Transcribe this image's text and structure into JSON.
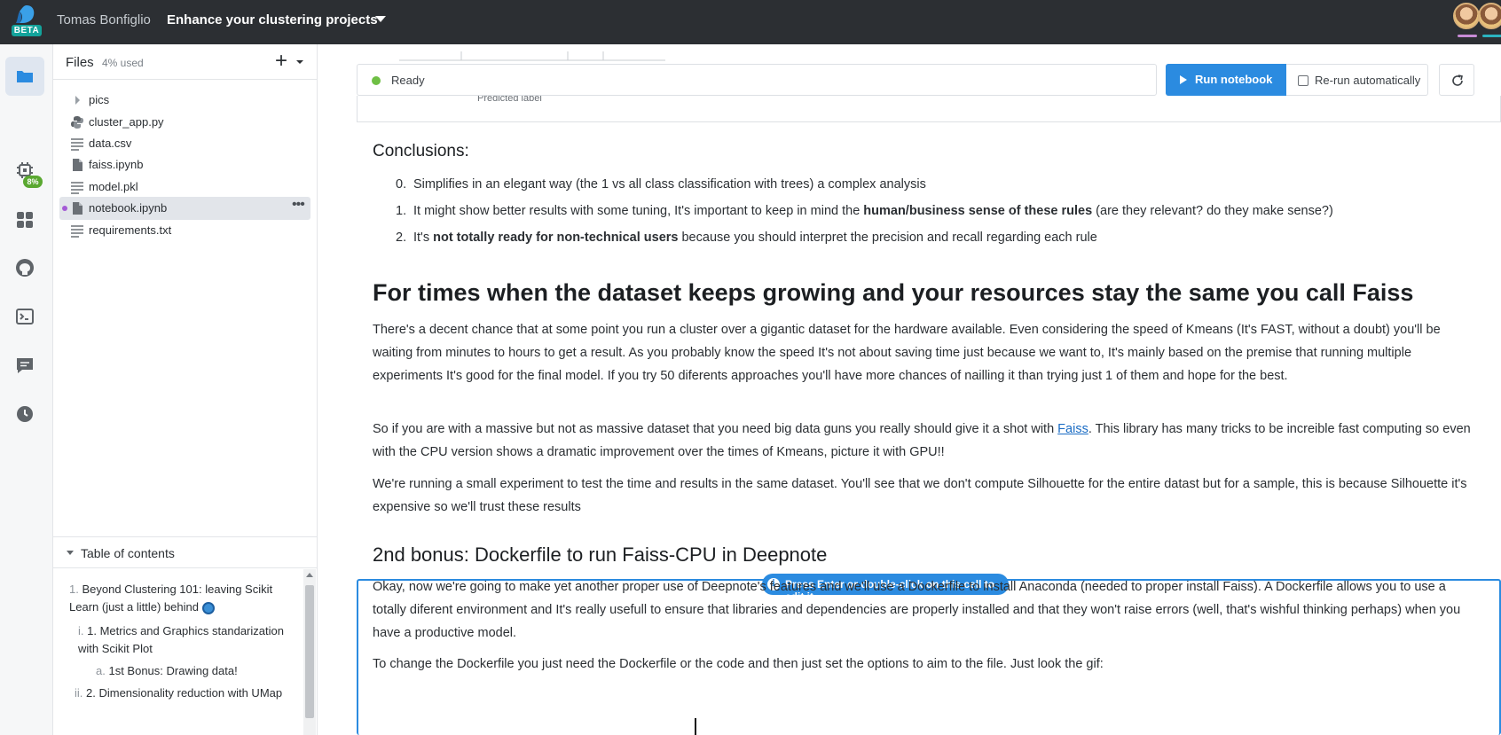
{
  "topbar": {
    "owner": "Tomas Bonfiglio",
    "project_title": "Enhance your clustering projects",
    "beta_label": "BETA",
    "accent": "#13a39b"
  },
  "rail": {
    "icons": [
      "folder-icon",
      "environment-icon",
      "integrations-icon",
      "github-icon",
      "terminal-icon",
      "comments-icon",
      "history-icon"
    ],
    "environment_usage": "8%"
  },
  "files": {
    "title": "Files",
    "usage": "4% used",
    "items": [
      {
        "name": "pics",
        "type": "folder"
      },
      {
        "name": "cluster_app.py",
        "type": "python"
      },
      {
        "name": "data.csv",
        "type": "text"
      },
      {
        "name": "faiss.ipynb",
        "type": "notebook"
      },
      {
        "name": "model.pkl",
        "type": "text"
      },
      {
        "name": "notebook.ipynb",
        "type": "notebook",
        "selected": true
      },
      {
        "name": "requirements.txt",
        "type": "text"
      }
    ]
  },
  "toc": {
    "title": "Table of contents",
    "items": [
      {
        "num": "1.",
        "text": "Beyond Clustering 101: leaving Scikit Learn (just a little) behind"
      },
      {
        "num": "i.",
        "text": "1. Metrics and Graphics standarization with Scikit Plot"
      },
      {
        "num": "a.",
        "text": "1st Bonus: Drawing data!"
      },
      {
        "num": "ii.",
        "text": "2. Dimensionality reduction with UMap"
      }
    ]
  },
  "toolbar": {
    "status": "Ready",
    "status_color": "#6fbf45",
    "run_label": "Run notebook",
    "rerun_label": "Re-run automatically",
    "rerun_checked": false,
    "primary_color": "#2b8be0"
  },
  "cell_output": {
    "axis_label": "Predicted label"
  },
  "content": {
    "conclusions_title": "Conclusions:",
    "conclusions": [
      {
        "n": "0.",
        "pre": "Simplifies in an elegant way (the 1 vs all class classification with trees) a complex analysis",
        "bold": "",
        "post": ""
      },
      {
        "n": "1.",
        "pre": "It might show better results with some tuning, It's important to keep in mind the ",
        "bold": "human/business sense of these rules",
        "post": " (are they relevant? do they make sense?)"
      },
      {
        "n": "2.",
        "pre": "It's ",
        "bold": "not totally ready for non-technical users",
        "post": " because you should interpret the precision and recall regarding each rule"
      }
    ],
    "faiss_heading": "For times when the dataset keeps growing and your resources stay the same you call Faiss",
    "para1": "There's a decent chance that at some point you run a cluster over a gigantic dataset for the hardware available. Even considering the speed of Kmeans (It's FAST, without a doubt) you'll be waiting from minutes to hours to get a result. As you probably know the speed It's not about saving time just because we want to, It's mainly based on the premise that running multiple experiments It's good for the final model. If you try 50 diferents approaches you'll have more chances of nailling it than trying just 1 of them and hope for the best.",
    "para2_pre": "So if you are with a massive but not as massive dataset that you need big data guns you really should give it a shot with ",
    "para2_link": "Faiss",
    "para2_post": ". This library has many tricks to be increible fast computing so even with the CPU version shows a dramatic improvement over the times of Kmeans, picture it with GPU!!",
    "para3": "We're running a small experiment to test the time and results in the same dataset. You'll see that we don't compute Silhouette for the entire datast but for a sample, this is because Silhouette it's expensive so we'll trust these results",
    "edit_tip": "Press Enter or double-click on this cell to edit it.",
    "bonus_heading": "2nd bonus: Dockerfile to run Faiss-CPU in Deepnote",
    "para4": "Okay, now we're going to make yet another proper use of Deepnote's features and we'll use a Dockerfile to install Anaconda (needed to proper install Faiss). A Dockerfile allows you to use a totally diferent environment and It's really usefull to ensure that libraries and dependencies are properly installed and that they won't raise errors (well, that's wishful thinking perhaps) when you have a productive model.",
    "para5": "To change the Dockerfile you just need the Dockerfile or the code and then just set the options to aim to the file. Just look the gif:"
  }
}
